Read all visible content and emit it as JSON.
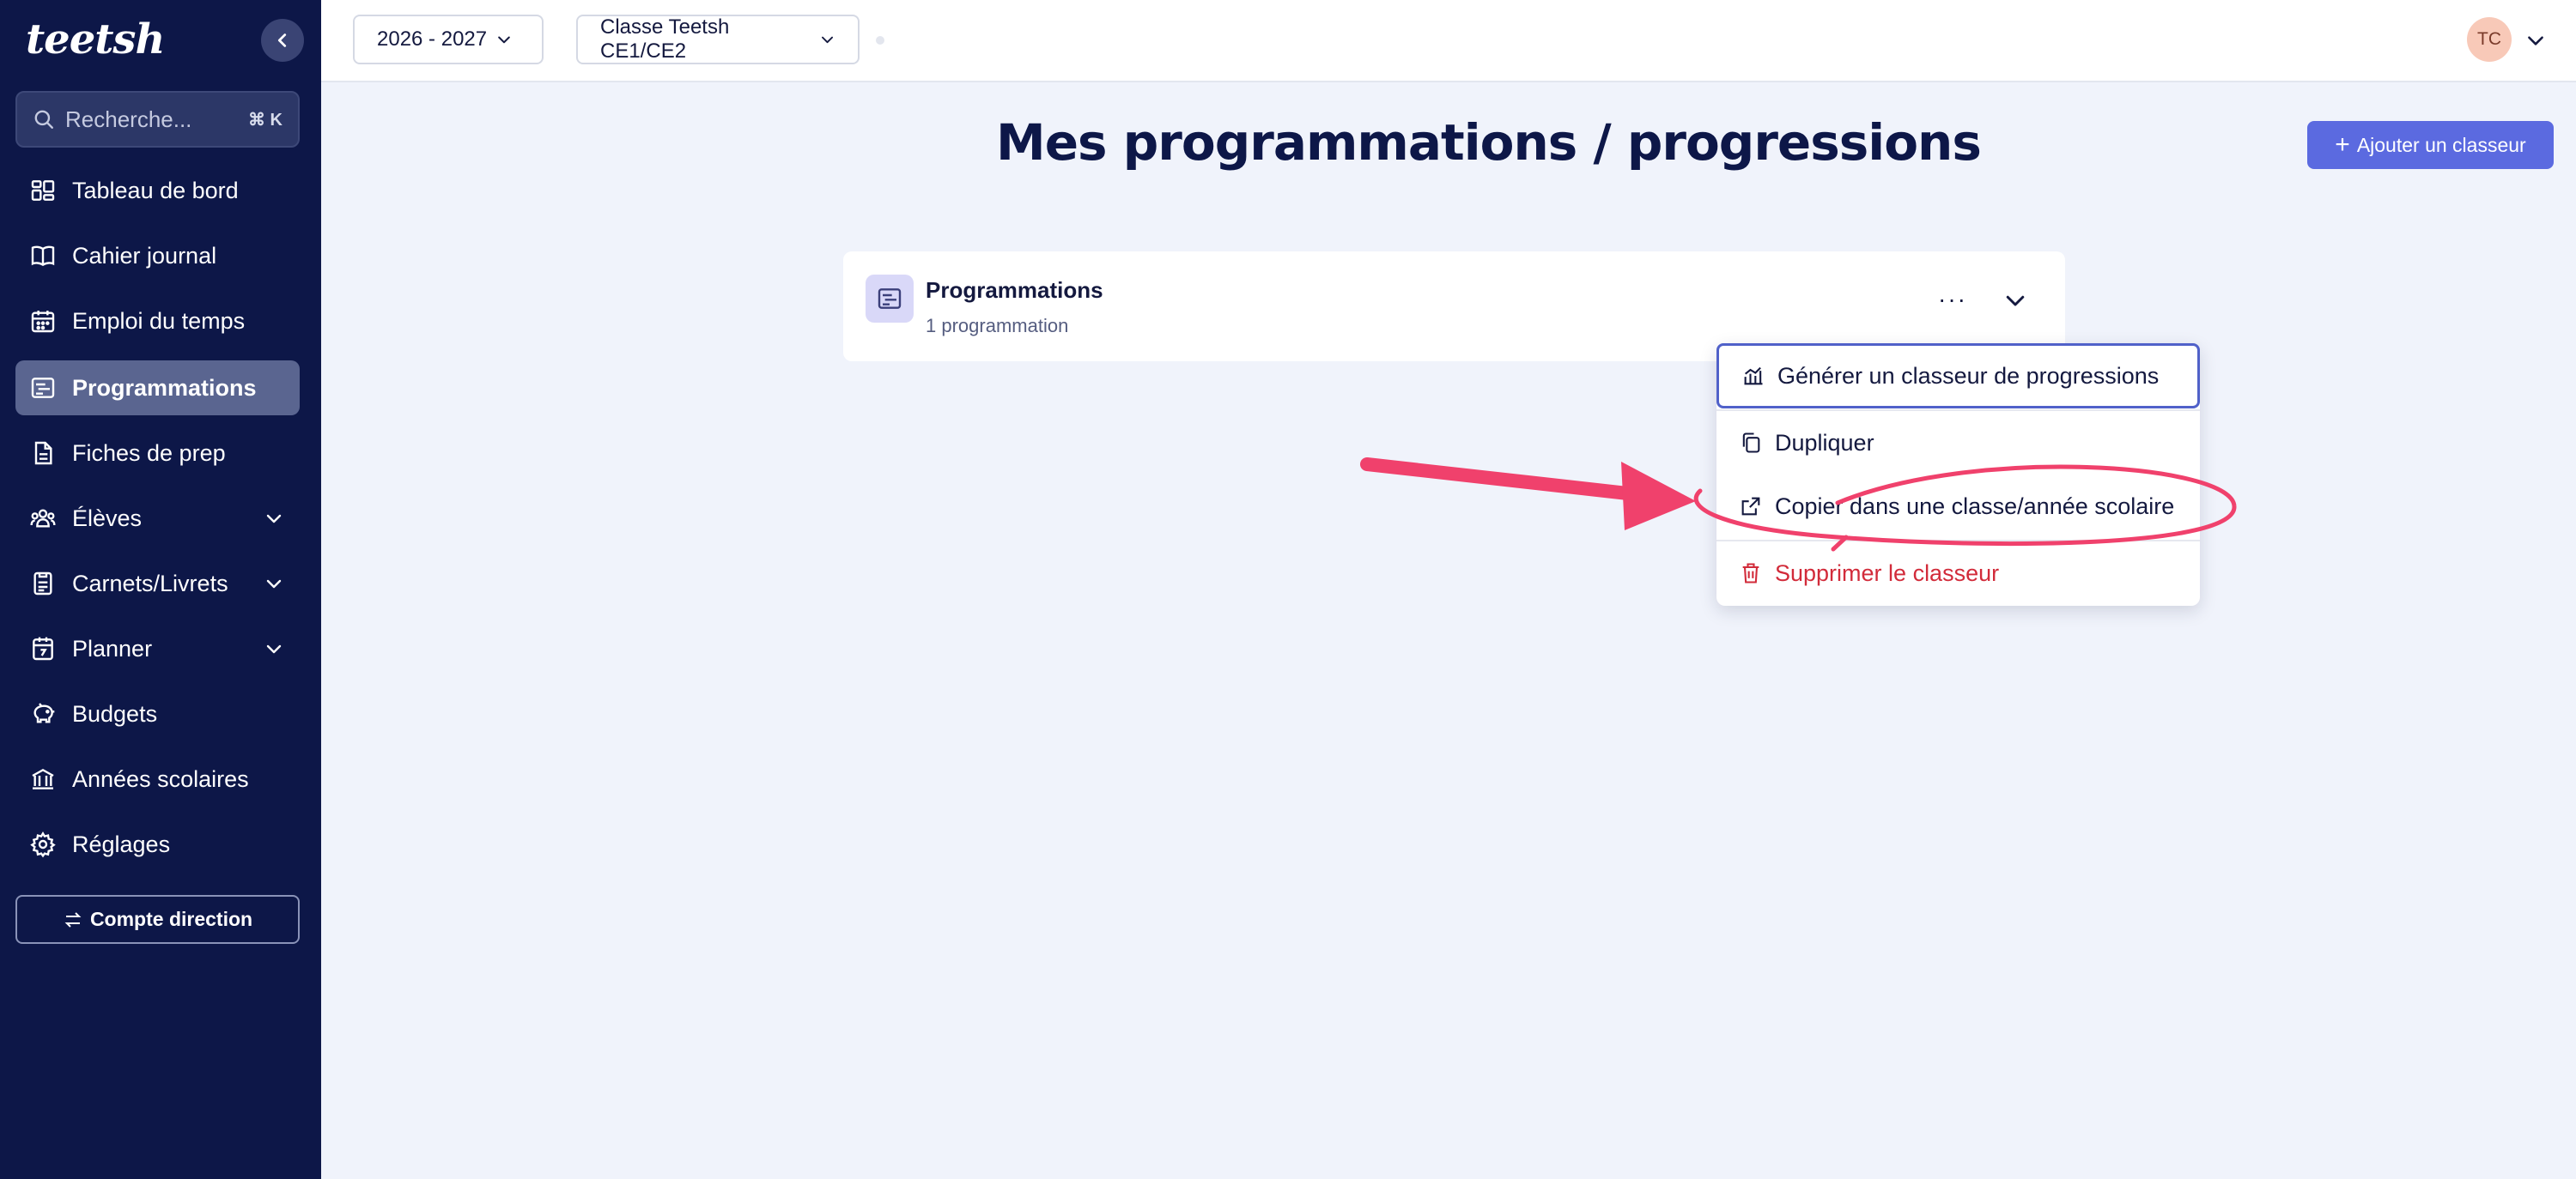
{
  "brand": {
    "logo_text": "teetsh",
    "accent_color": "#ff4f7b",
    "sidebar_color": "#0d1748",
    "primary_button_color": "#5b6ae0"
  },
  "search": {
    "placeholder": "Recherche...",
    "shortcut": "⌘ K"
  },
  "sidebar": {
    "items": [
      {
        "label": "Tableau de bord",
        "icon": "dashboard-icon"
      },
      {
        "label": "Cahier journal",
        "icon": "book-icon"
      },
      {
        "label": "Emploi du temps",
        "icon": "calendar-icon"
      },
      {
        "label": "Programmations",
        "icon": "programmation-icon",
        "active": true
      },
      {
        "label": "Fiches de prep",
        "icon": "file-icon"
      },
      {
        "label": "Élèves",
        "icon": "students-icon",
        "expandable": true
      },
      {
        "label": "Carnets/Livrets",
        "icon": "notebook-icon",
        "expandable": true
      },
      {
        "label": "Planner",
        "icon": "planner-icon",
        "expandable": true
      },
      {
        "label": "Budgets",
        "icon": "piggy-bank-icon"
      },
      {
        "label": "Années scolaires",
        "icon": "school-icon"
      },
      {
        "label": "Réglages",
        "icon": "gear-icon"
      }
    ],
    "account_button": "Compte direction"
  },
  "topbar": {
    "year_selector": "2026 - 2027",
    "class_selector": "Classe Teetsh CE1/CE2",
    "user_initials": "TC"
  },
  "main": {
    "title": "Mes programmations / progressions",
    "add_button": "Ajouter un classeur",
    "card": {
      "title": "Programmations",
      "subtitle": "1 programmation"
    }
  },
  "menu": {
    "items": [
      {
        "label": "Générer un classeur de progressions",
        "icon": "chart-icon"
      },
      {
        "label": "Dupliquer",
        "icon": "copy-icon"
      },
      {
        "label": "Copier dans une classe/année scolaire",
        "icon": "external-link-icon"
      },
      {
        "label": "Supprimer le classeur",
        "icon": "trash-icon",
        "danger": true
      }
    ]
  },
  "annotation_color": "#f0416c"
}
